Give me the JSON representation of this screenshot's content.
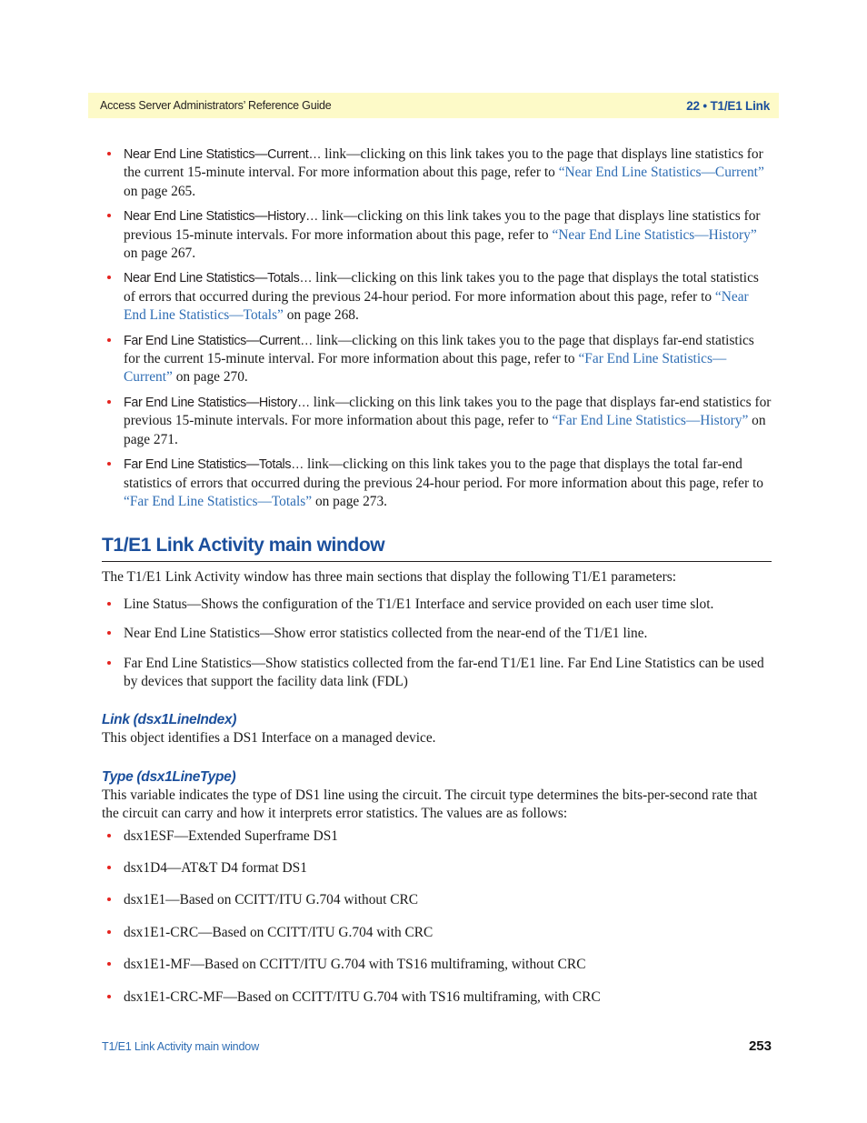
{
  "header": {
    "left_text": "Access Server Administrators’ Reference Guide",
    "right_text": "22 • T1/E1 Link",
    "band_color": "#fdfac8",
    "right_text_color": "#1b4f9c"
  },
  "link_bullets": [
    {
      "name": "Near End Line Statistics—Current…",
      "body_before": " link—clicking on this link takes you to the page that displays line statistics for the current 15-minute interval. For more information about this page, refer to ",
      "xref": "“Near End Line Statistics—Current”",
      "body_after": " on page 265."
    },
    {
      "name": "Near End Line Statistics—History…",
      "body_before": " link—clicking on this link takes you to the page that displays line statistics for previous 15-minute intervals. For more information about this page, refer to ",
      "xref": "“Near End Line Statistics—History”",
      "body_after": " on page 267."
    },
    {
      "name": "Near End Line Statistics—Totals…",
      "body_before": " link—clicking on this link takes you to the page that displays the total statistics of errors that occurred during the previous 24-hour period. For more information about this page, refer to ",
      "xref": "“Near End Line Statistics—Totals”",
      "body_after": " on page 268."
    },
    {
      "name": "Far End Line Statistics—Current…",
      "body_before": " link—clicking on this link takes you to the page that displays far-end statistics for the current 15-minute interval. For more information about this page, refer to ",
      "xref": "“Far End Line Statistics—Current”",
      "body_after": " on page 270."
    },
    {
      "name": "Far End Line Statistics—History…",
      "body_before": " link—clicking on this link takes you to the page that displays far-end statistics for previous 15-minute intervals. For more information about this page, refer to ",
      "xref": "“Far End Line Statistics—History”",
      "body_after": " on page 271."
    },
    {
      "name": "Far End Line Statistics—Totals…",
      "body_before": " link—clicking on this link takes you to the page that displays the total far-end statistics of errors that occurred during the previous 24-hour period. For more information about this page, refer to ",
      "xref": "“Far End Line Statistics—Totals”",
      "body_after": " on page 273."
    }
  ],
  "section": {
    "heading": "T1/E1 Link Activity main window",
    "intro": "The T1/E1 Link Activity window has three main sections that display the following T1/E1 parameters:",
    "parameters": [
      "Line Status—Shows the configuration of the T1/E1 Interface and service provided on each user time slot.",
      "Near End Line Statistics—Show error statistics collected from the near-end of the T1/E1 line.",
      "Far End Line Statistics—Show statistics collected from the far-end T1/E1 line. Far End Line Statistics can be used by devices that support the facility data link (FDL)"
    ]
  },
  "link_object": {
    "heading": "Link (dsx1LineIndex)",
    "body": "This object identifies a DS1 Interface on a managed device."
  },
  "type_object": {
    "heading": "Type (dsx1LineType)",
    "body": "This variable indicates the type of DS1 line using the circuit. The circuit type determines the bits-per-second rate that the circuit can carry and how it interprets error statistics. The values are as follows:",
    "values": [
      "dsx1ESF—Extended Superframe DS1",
      "dsx1D4—AT&T D4 format DS1",
      "dsx1E1—Based on CCITT/ITU G.704 without CRC",
      "dsx1E1-CRC—Based on CCITT/ITU G.704 with CRC",
      "dsx1E1-MF—Based on CCITT/ITU G.704 with TS16 multiframing, without CRC",
      "dsx1E1-CRC-MF—Based on CCITT/ITU G.704 with TS16 multiframing, with CRC"
    ]
  },
  "footer": {
    "left_text": "T1/E1 Link Activity main window",
    "page_number": "253",
    "left_text_color": "#2e6db4"
  },
  "colors": {
    "bullet": "#e4231f",
    "xref_link": "#2e6db4",
    "heading_blue": "#1b4f9c",
    "body_text": "#1a1a1a"
  }
}
